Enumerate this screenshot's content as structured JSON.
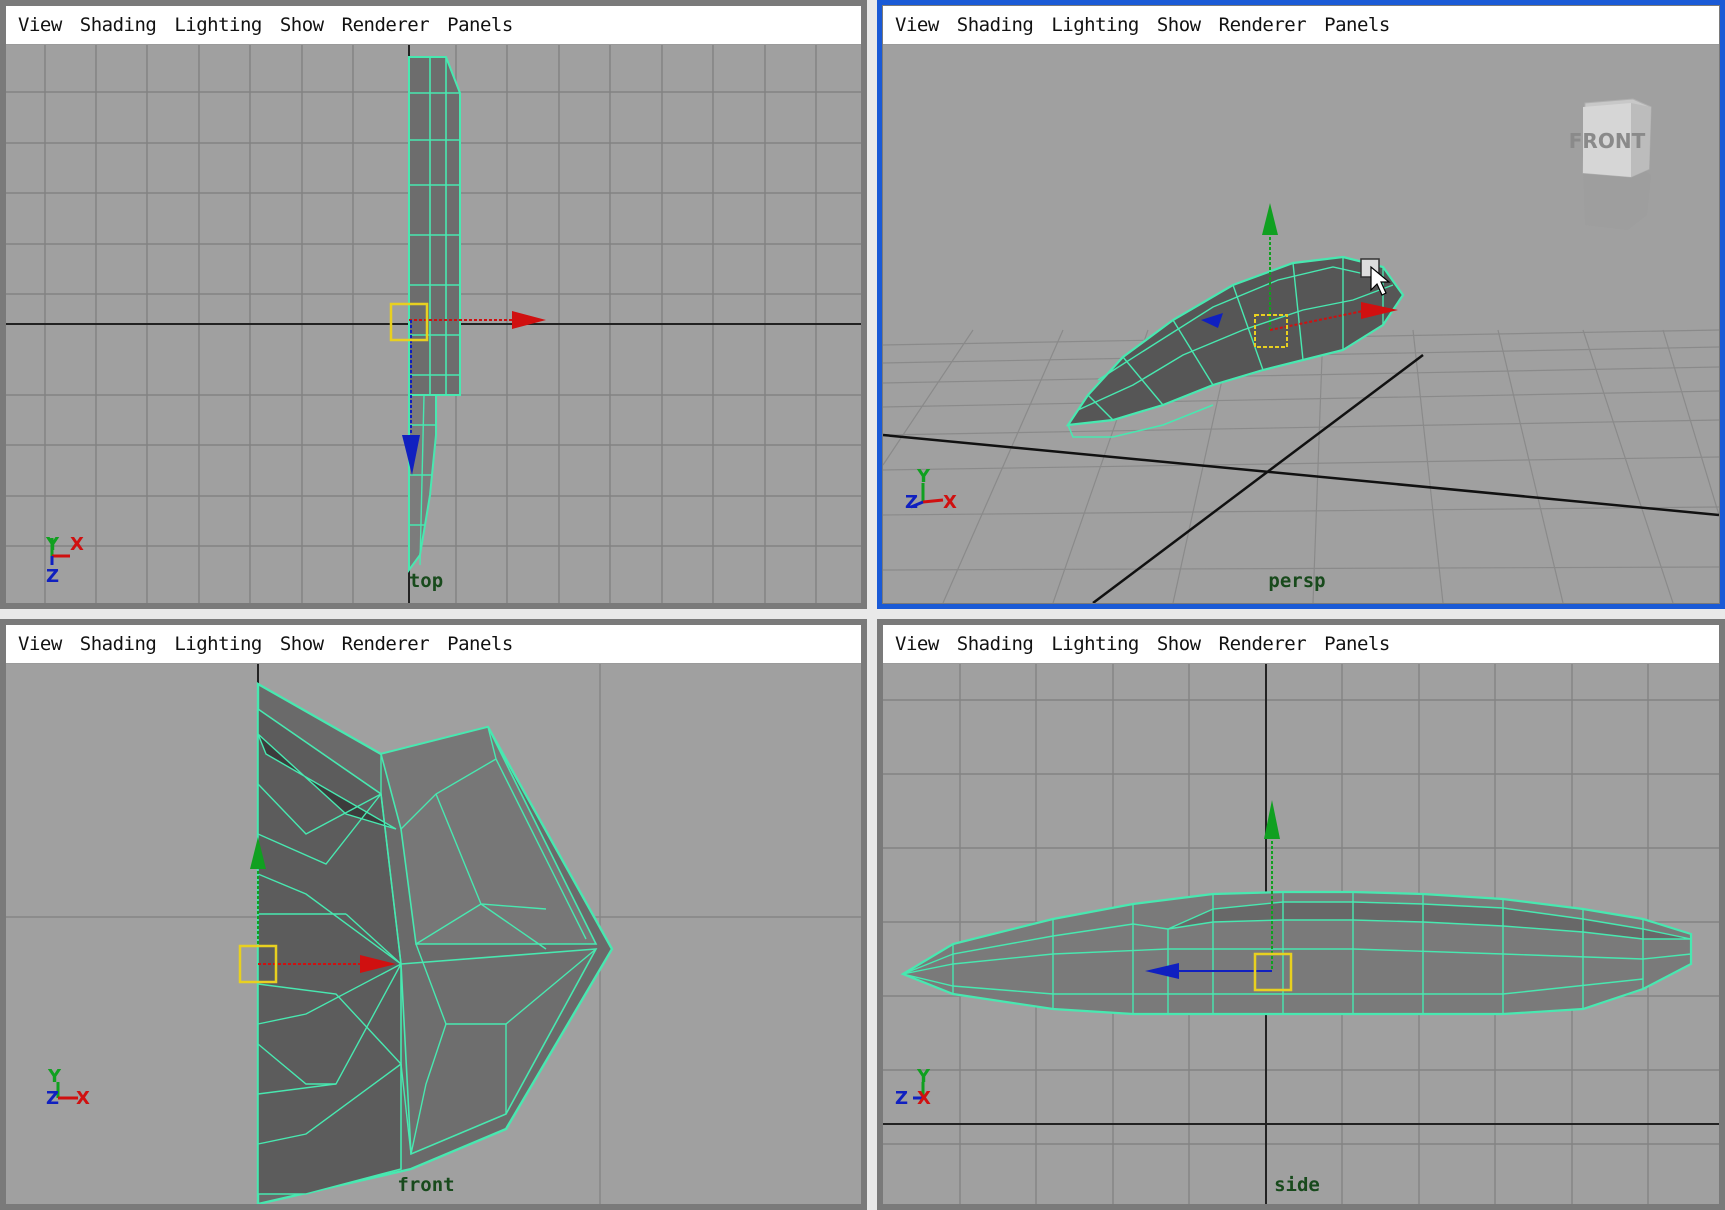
{
  "menu": [
    "View",
    "Shading",
    "Lighting",
    "Show",
    "Renderer",
    "Panels"
  ],
  "viewports": {
    "top": {
      "camera": "top",
      "axis_labels": [
        "Y",
        "X",
        "Z"
      ]
    },
    "persp": {
      "camera": "persp",
      "axis_labels": [
        "Y",
        "Z",
        "X"
      ],
      "viewcube_label": "FRONT"
    },
    "front": {
      "camera": "front",
      "axis_labels": [
        "Y",
        "Z",
        "X"
      ]
    },
    "side": {
      "camera": "side",
      "axis_labels": [
        "Y",
        "Z",
        "X"
      ]
    }
  },
  "active_viewport": "persp",
  "colors": {
    "viewport_bg": "#a0a0a0",
    "grid": "#7f7f7f",
    "wire": "#48e8b0",
    "active_border": "#1a5ad6",
    "pivot": "#e8d020",
    "manip_x": "#d01010",
    "manip_y": "#10a020",
    "manip_z": "#1020c0"
  }
}
